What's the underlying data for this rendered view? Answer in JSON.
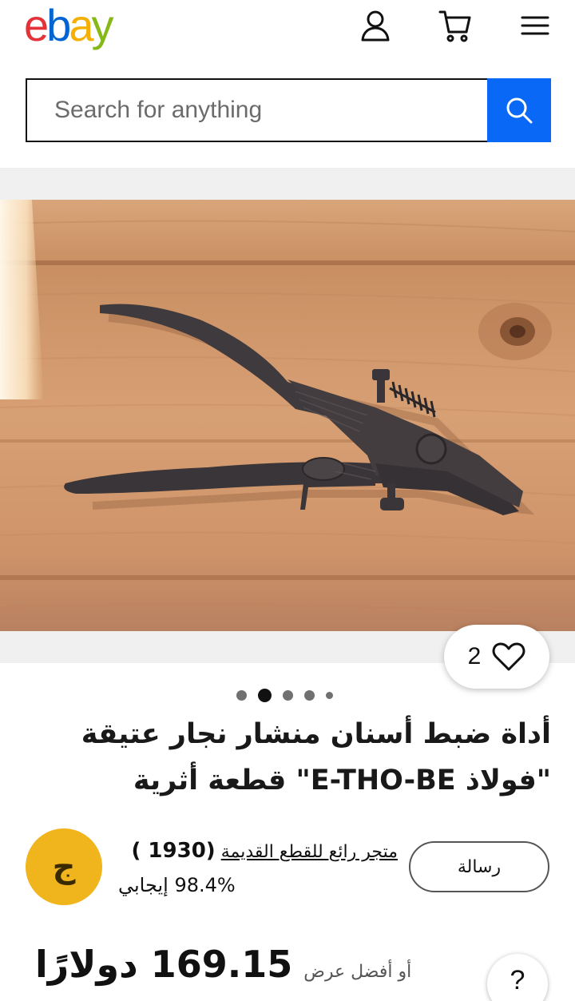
{
  "header": {
    "logo": {
      "e": "e",
      "b": "b",
      "a": "a",
      "y": "y"
    },
    "icons": [
      "account-icon",
      "cart-icon",
      "menu-icon"
    ]
  },
  "search": {
    "placeholder": "Search for anything",
    "button_icon": "search-icon"
  },
  "gallery": {
    "watch_count": "2",
    "image_count": 5,
    "active_image_index": 1
  },
  "listing": {
    "title": "أداة ضبط أسنان منشار نجار عتيقة \"فولاذ E-THO-BE\" قطعة أثرية"
  },
  "seller": {
    "avatar_letter": "ج",
    "store_name": "متجر رائع للقطع القديمة",
    "feedback_count": "(1930 )",
    "feedback_percent": "98.4% إيجابي",
    "message_label": "رسالة"
  },
  "price": {
    "amount": "169.15 دولارًا",
    "best_offer": "أو أفضل عرض"
  },
  "help": {
    "label": "?"
  },
  "colors": {
    "search_button": "#0968f6",
    "avatar": "#f0b41c",
    "logo_red": "#e53238",
    "logo_blue": "#0064d2",
    "logo_yellow": "#f5af02",
    "logo_green": "#86b817"
  }
}
